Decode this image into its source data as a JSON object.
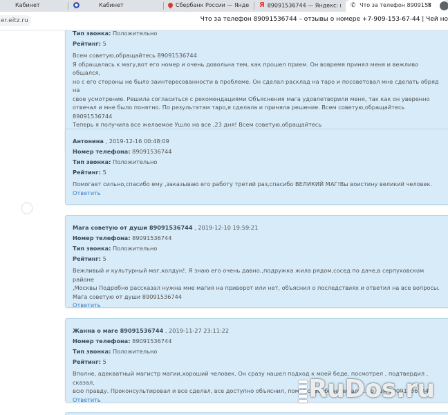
{
  "browser": {
    "tabs": [
      {
        "title": "Кабинет"
      },
      {
        "title": "Кабинет"
      },
      {
        "title": "Сбербанк России — Янде"
      },
      {
        "title": "89091536744 — Яндекс: н"
      },
      {
        "title": "Что за телефон 8909153",
        "active": true
      }
    ],
    "url": "er.eitz.ru",
    "colors": {
      "yandex_red": "#e8352b",
      "sber_red": "#d93b2b",
      "tab_bg": "#dee1e6"
    }
  },
  "page": {
    "header": "Что за телефон 89091536744 – отзывы о номере +7-909-153-67-44 | Чей но"
  },
  "labels": {
    "phone": "Номер телефона:",
    "call_type": "Тип звонка:",
    "rating": "Рейтинг:",
    "reply": "Ответить"
  },
  "reviews": [
    {
      "call_type_label": "Тип звонка:",
      "call_type": "Положительно",
      "rating": "5",
      "lines": [
        "Всем советую,обращайтесь 89091536744",
        "Я обращалась к магу,вот его номер и очень довольна тем, как прошел прием. Он вовремя принял меня и вежливо общался,",
        "но с его стороны не было заинтересованности в проблеме. Он сделал расклад на таро и посоветовал мне сделать обряд на",
        "свое усмотрение. Решила согласиться с рекомендациями Объяснения мага удовлетворили меня, так как он уверенно",
        "отвечал и мне было понятно. По результатам таро,я сделала и приняла решение. Всем советую,обращайтесь 89091536744",
        "Теперь я получила все желаемое Ушло на все ,23 дня! Всем советую,обращайтесь"
      ]
    },
    {
      "name": "Антонина",
      "date": ", 2019-12-16 00:48:09",
      "phone": "89091536744",
      "call_type": "Положительно",
      "rating": "5",
      "lines": [
        "Помогает сильно,спасибо ему ,заказываю его работу третий раз,спасибо ВЕЛИКИЙ МАГ!Вы воистину великий человек."
      ]
    },
    {
      "name": "Мага советую от души 89091536744",
      "date": ", 2019-12-10 19:59:21",
      "phone": "89091536744",
      "call_type": "Положительно",
      "rating": "5",
      "lines": [
        "Вежливый и культурный маг,колдун!. Я знаю его очень давно.,подружка жила рядом,сосед по даче,в серпуховском районе",
        ",Москвы Подробно рассказал нужна мне магия на приворот или нет, объяснил о последствиях и ответил на все вопросы.",
        "Мага советую от души 89091536744"
      ]
    },
    {
      "name": "Жанна о маге 89091536744",
      "date": ", 2019-11-27 23:11:22",
      "phone": "89091536744",
      "call_type": "Положительно",
      "rating": "5",
      "lines": [
        "Вполне, адекватный магистр магии,хороший человек. Он сразу нашел подход к моей беде, посмотрел , подтвердил , сказал,",
        "всю правду. Проконсультировал и все сделал, все доступно объяснил, помог,спасибо,написал а... о нем 89091536744"
      ]
    }
  ],
  "watermark": {
    "text": "RuDos.ru"
  }
}
